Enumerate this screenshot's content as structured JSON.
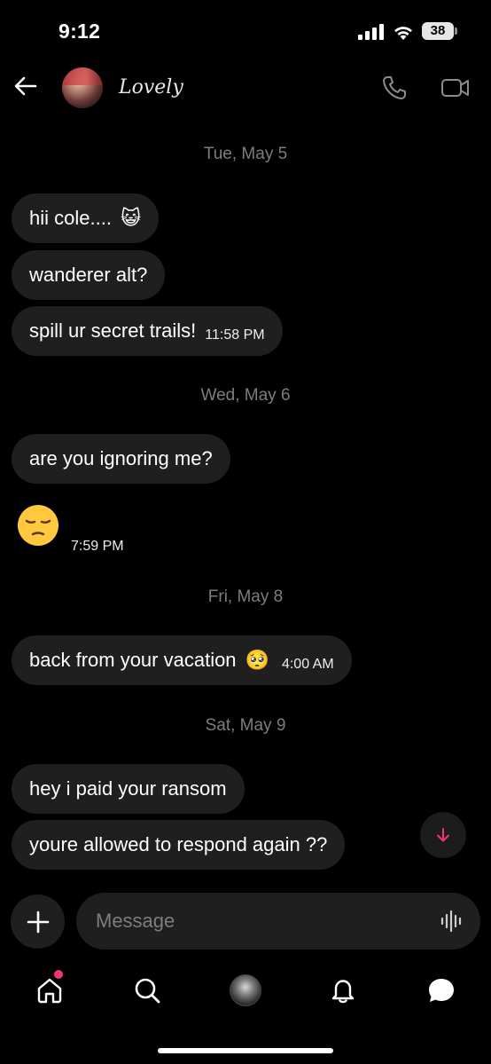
{
  "status_bar": {
    "time": "9:12",
    "battery": "38"
  },
  "header": {
    "contact_name": "Lovely"
  },
  "dates": [
    "Tue, May 5",
    "Wed, May 6",
    "Fri, May 8",
    "Sat, May 9"
  ],
  "messages": {
    "m1": {
      "text": "hii cole....",
      "emoji": "😺"
    },
    "m2": {
      "text": "wanderer alt?"
    },
    "m3": {
      "text": "spill ur secret trails!",
      "time": "11:58 PM"
    },
    "m4": {
      "text": "are you ignoring me?"
    },
    "m5": {
      "emoji": "😔",
      "time": "7:59 PM"
    },
    "m6": {
      "text": "back from your vacation",
      "emoji": "🥺",
      "time": "4:00 AM"
    },
    "m7": {
      "text": "hey i paid your ransom"
    },
    "m8": {
      "text": "youre allowed to respond again ??"
    }
  },
  "composer": {
    "placeholder": "Message"
  },
  "icons": [
    "back-arrow",
    "phone",
    "video-camera",
    "arrow-down",
    "plus",
    "voice-waveform",
    "home",
    "search",
    "bell",
    "chat-bubble"
  ],
  "colors": {
    "background": "#000000",
    "bubble": "#1f1f1f",
    "accent": "#f2357b",
    "muted": "#7d7d7d"
  }
}
